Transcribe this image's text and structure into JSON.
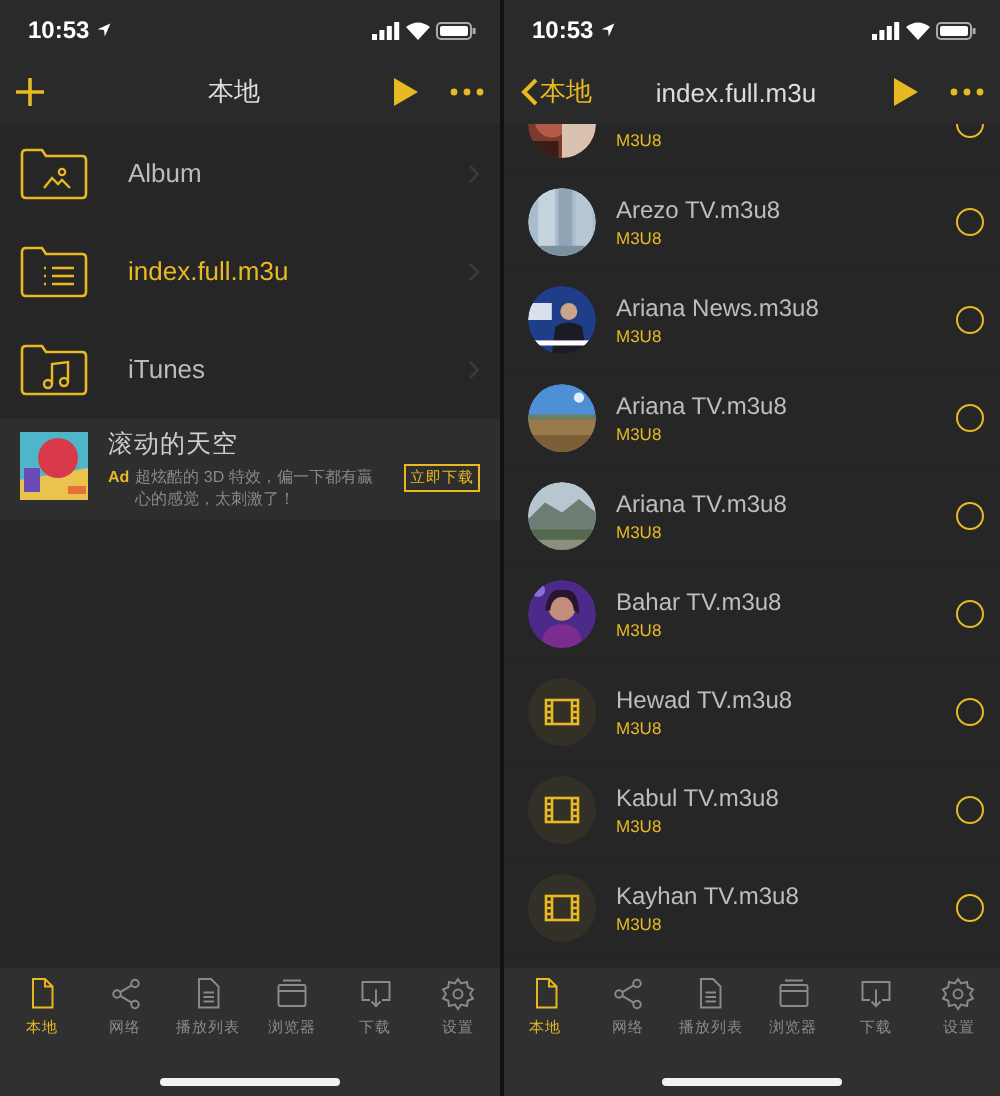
{
  "screens": [
    {
      "status_bar": {
        "time": "10:53"
      },
      "nav": {
        "left": {
          "kind": "add"
        },
        "title": "本地"
      },
      "folders": [
        {
          "name": "Album",
          "selected": false
        },
        {
          "name": "index.full.m3u",
          "selected": true
        },
        {
          "name": "iTunes",
          "selected": false
        }
      ],
      "ad": {
        "title": "滚动的天空",
        "badge": "Ad",
        "description": "超炫酷的 3D 特效，偏一下都有贏心的感觉，太刺激了！",
        "button": "立即下载"
      },
      "tab_bar": [
        {
          "label": "本地",
          "selected": true
        },
        {
          "label": "网络",
          "selected": false
        },
        {
          "label": "播放列表",
          "selected": false
        },
        {
          "label": "浏览器",
          "selected": false
        },
        {
          "label": "下载",
          "selected": false
        },
        {
          "label": "设置",
          "selected": false
        }
      ]
    },
    {
      "status_bar": {
        "time": "10:53"
      },
      "nav": {
        "left": {
          "kind": "back",
          "label": "本地"
        },
        "title": "index.full.m3u"
      },
      "files": [
        {
          "type": "M3U8",
          "kind": "picture",
          "selected": false
        },
        {
          "name": "Arezo TV.m3u8",
          "type": "M3U8",
          "kind": "picture",
          "selected": false
        },
        {
          "name": "Ariana News.m3u8",
          "type": "M3U8",
          "kind": "picture",
          "selected": false
        },
        {
          "name": "Ariana TV.m3u8",
          "type": "M3U8",
          "kind": "picture",
          "selected": false
        },
        {
          "name": "Ariana TV.m3u8",
          "type": "M3U8",
          "kind": "picture",
          "selected": false
        },
        {
          "name": "Bahar TV.m3u8",
          "type": "M3U8",
          "kind": "picture",
          "selected": false
        },
        {
          "name": "Hewad TV.m3u8",
          "type": "M3U8",
          "kind": "video",
          "selected": false
        },
        {
          "name": "Kabul TV.m3u8",
          "type": "M3U8",
          "kind": "video",
          "selected": false
        },
        {
          "name": "Kayhan TV.m3u8",
          "type": "M3U8",
          "kind": "video",
          "selected": false
        }
      ],
      "tab_bar": [
        {
          "label": "本地",
          "selected": true
        },
        {
          "label": "网络",
          "selected": false
        },
        {
          "label": "播放列表",
          "selected": false
        },
        {
          "label": "浏览器",
          "selected": false
        },
        {
          "label": "下载",
          "selected": false
        },
        {
          "label": "设置",
          "selected": false
        }
      ]
    }
  ]
}
